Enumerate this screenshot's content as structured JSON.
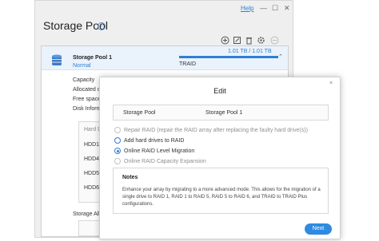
{
  "window": {
    "title": "Storage Pool",
    "help_label": "Help",
    "controls": [
      "—",
      "☐",
      "✕"
    ]
  },
  "pool": {
    "name": "Storage Pool 1",
    "status": "Normal",
    "capacity": "1.01 TB / 1.01 TB",
    "capacity_used_fraction": 1.0,
    "raid_type": "TRAID",
    "details": [
      "Capacity",
      "Allocated ca",
      "Free space",
      "Disk Informa"
    ],
    "disk_table_header": "Hard Driv",
    "disks": [
      "HDD1",
      "HDD4",
      "HDD5",
      "HDD6"
    ],
    "storage_alloc_label": "Storage Allo"
  },
  "dialog": {
    "title": "Edit",
    "close_label": "×",
    "info_key": "Storage Pool",
    "info_value": "Storage Pool 1",
    "options": [
      {
        "label": "Repair RAID (repair the RAID array after replacing the faulty hard drive(s))",
        "state": "disabled"
      },
      {
        "label": "Add hard drives to RAID",
        "state": "highlight"
      },
      {
        "label": "Online RAID Level Migration",
        "state": "selected"
      },
      {
        "label": "Online RAID Capacity Expansion",
        "state": "disabled"
      }
    ],
    "notes_title": "Notes",
    "notes_text": "Enhance your array by migrating to a more advanced mode. This allows for the migration of a single drive to RAID 1, RAID 1 to RAID 5, RAID 5 to RAID 6, and TRAID to TRAID Plus configurations.",
    "next_label": "Next"
  },
  "colors": {
    "accent": "#2f7fd3",
    "button": "#2f8be0",
    "header_bg": "#eaf2fb"
  },
  "icons": [
    "info-icon",
    "add-icon",
    "edit-icon",
    "delete-icon",
    "settings-icon",
    "disabled-icon",
    "database-icon",
    "chevron-up-icon",
    "close-icon"
  ]
}
